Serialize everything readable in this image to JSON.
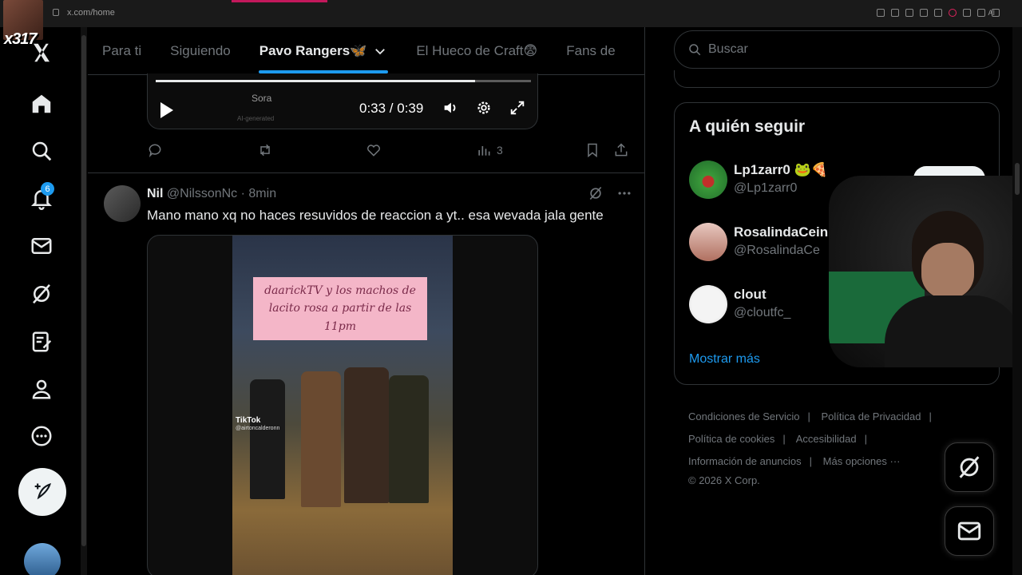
{
  "browser": {
    "url": "x.com/home",
    "ai_label": "AI"
  },
  "overlay": {
    "channel_tag": "x317"
  },
  "nav": {
    "items": [
      {
        "name": "home-icon"
      },
      {
        "name": "explore-icon"
      },
      {
        "name": "notifications-icon",
        "badge": "6"
      },
      {
        "name": "messages-icon"
      },
      {
        "name": "grok-icon"
      },
      {
        "name": "lists-icon"
      },
      {
        "name": "profile-icon"
      },
      {
        "name": "more-icon"
      }
    ]
  },
  "tabs": [
    {
      "label": "Para ti",
      "active": false
    },
    {
      "label": "Siguiendo",
      "active": false
    },
    {
      "label": "Pavo Rangers🦋",
      "active": true
    },
    {
      "label": "El Hueco de Craft😨",
      "active": false
    },
    {
      "label": "Fans de",
      "active": false
    }
  ],
  "video_player": {
    "progress_fraction": 0.85,
    "watermark": "Sora",
    "watermark_sub": "AI-generated",
    "time": "0:33 / 0:39"
  },
  "prev_post_actions": {
    "views": "3"
  },
  "post": {
    "name": "Nil",
    "handle": "@NilssonNc",
    "time": "8min",
    "text": "Mano mano xq no haces resuvidos de reaccion a yt.. esa wevada jala gente",
    "media": {
      "caption": "daarickTV y los machos de lacito rosa a partir de las 11pm",
      "tiktok_label": "TikTok",
      "tiktok_handle": "@airtoncalderonn"
    }
  },
  "search": {
    "placeholder": "Buscar"
  },
  "who_to_follow": {
    "title": "A quién seguir",
    "accounts": [
      {
        "name": "Lp1zarr0 🐸🍕",
        "handle": "@Lp1zarr0"
      },
      {
        "name": "RosalindaCein",
        "handle": "@RosalindaCe"
      },
      {
        "name": "clout",
        "handle": "@cloutfc_"
      }
    ],
    "show_more": "Mostrar más"
  },
  "footer": {
    "links": [
      "Condiciones de Servicio",
      "Política de Privacidad",
      "Política de cookies",
      "Accesibilidad",
      "Información de anuncios",
      "Más opciones ···"
    ],
    "copyright": "© 2026 X Corp."
  },
  "colors": {
    "accent": "#1d9bf0",
    "background": "#000000",
    "text": "#e7e9ea",
    "muted": "#71767b",
    "border": "#2f3336"
  }
}
